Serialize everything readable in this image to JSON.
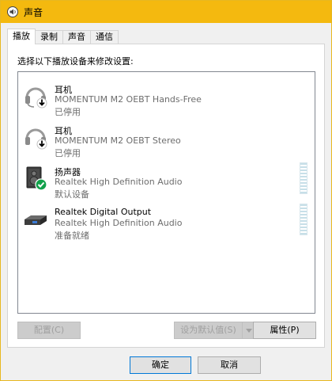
{
  "window": {
    "title": "声音"
  },
  "tabs": [
    {
      "label": "播放",
      "active": true
    },
    {
      "label": "录制",
      "active": false
    },
    {
      "label": "声音",
      "active": false
    },
    {
      "label": "通信",
      "active": false
    }
  ],
  "instruction": "选择以下播放设备来修改设置:",
  "devices": [
    {
      "name": "耳机",
      "description": "MOMENTUM M2 OEBT Hands-Free",
      "status": "已停用",
      "icon": "headset-icon"
    },
    {
      "name": "耳机",
      "description": "MOMENTUM M2 OEBT Stereo",
      "status": "已停用",
      "icon": "headphones-icon"
    },
    {
      "name": "扬声器",
      "description": "Realtek High Definition Audio",
      "status": "默认设备",
      "icon": "speaker-icon"
    },
    {
      "name": "Realtek Digital Output",
      "description": "Realtek High Definition Audio",
      "status": "准备就绪",
      "icon": "digital-output-icon"
    }
  ],
  "buttons": {
    "configure": "配置(C)",
    "set_default": "设为默认值(S)",
    "properties": "属性(P)",
    "ok": "确定",
    "cancel": "取消"
  },
  "colors": {
    "titlebar": "#f4b90f",
    "default_check": "#12a14b",
    "focus_border": "#0078d7"
  }
}
